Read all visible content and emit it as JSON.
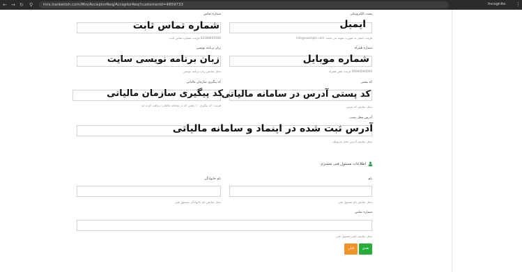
{
  "browser": {
    "url": "mrs.iranketish.com/Mrs/AcceptorReq/AcceptorReq?customerId=4859733",
    "profile_label": "Incognito"
  },
  "form": {
    "email": {
      "label": "پست الکترونیکی",
      "value": "ایمیل",
      "hint": "فرمت ایمیل به صورت نمونه می باشد: info@example.com"
    },
    "phone": {
      "label": "شماره تماس",
      "value": "شماره تماس ثابت",
      "hint": "02188445566 فرمت شماره تماس ثابت"
    },
    "mobile": {
      "label": "شماره همراه",
      "value": "شماره موبایل",
      "hint": "09000000000 فرمت تلفن همراه"
    },
    "lang": {
      "label": "زبان برنامه نویسی",
      "value": "زبان برنامه نویسی سایت",
      "hint": "محل نمایش زبان برنامه نویسی"
    },
    "postal": {
      "label": "کد پستی",
      "value": "کد پستی آدرس در سامانه مالیاتی",
      "hint": "محل نمایش کد پستی"
    },
    "tax": {
      "label": "کد پیگیری سازمان مالیاتی",
      "value": "کد پیگیری سازمان مالیاتی",
      "hint": "فرمت: کد پیگیری ۱۰ رقمی که در سامانه مالیاتی دریافت کرده اید"
    },
    "address": {
      "label": "آدرس محل نصب",
      "value": "آدرس ثبت شده در اینماد و سامانه مالیاتی",
      "hint": "محل نمایش آدرس محل مربوطه"
    }
  },
  "tech": {
    "section_title": "اطلاعات مسئول فنی مشتری",
    "first_name": {
      "label": "نام",
      "value": "",
      "hint": "محل نمایش نام مسئول فنی"
    },
    "last_name": {
      "label": "نام خانوادگی",
      "value": "",
      "hint": "محل نمایش نام خانوادگی مسئول فنی"
    },
    "phone": {
      "label": "شماره تماس",
      "value": "",
      "hint": "محل نمایش تلفن مسئول فنی"
    }
  },
  "buttons": {
    "next": "بعدی",
    "prev": "قبلی"
  },
  "colors": {
    "next": "#27ae3a",
    "prev": "#f0932b",
    "accent": "#2e9e4f"
  }
}
